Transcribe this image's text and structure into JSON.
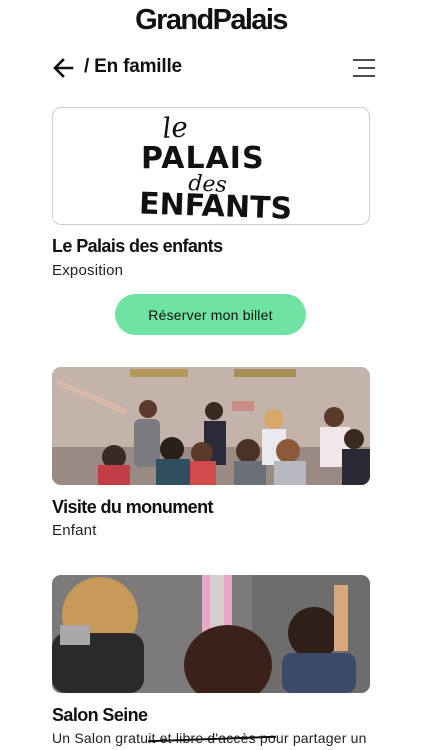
{
  "header": {
    "logo": "GrandPalais",
    "breadcrumb": "/ En famille"
  },
  "cards": [
    {
      "title": "Le Palais des enfants",
      "subtitle": "Exposition",
      "logo_text": {
        "line1": "le",
        "line2": "PALAIS",
        "line3": "des",
        "line4": "ENFANTS"
      },
      "cta": "Réserver mon billet"
    },
    {
      "title": "Visite du monument",
      "subtitle": "Enfant"
    },
    {
      "title": "Salon Seine",
      "description": "Un Salon gratuit et libre d'accès pour partager un"
    }
  ],
  "colors": {
    "accent": "#6fe3a1",
    "text": "#111111"
  },
  "icons": {
    "back": "arrow-left-icon",
    "menu": "hamburger-menu-icon"
  }
}
